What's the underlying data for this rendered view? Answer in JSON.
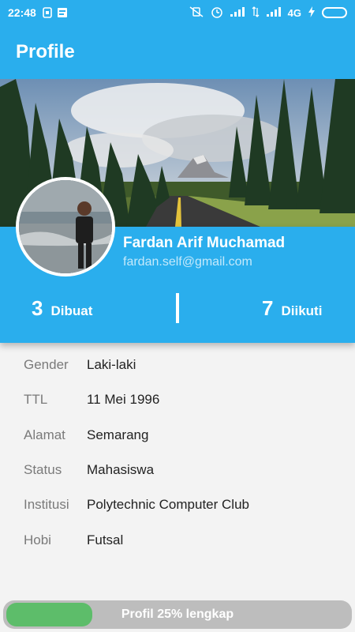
{
  "status_bar": {
    "time": "22:48",
    "network": "4G"
  },
  "header": {
    "title": "Profile"
  },
  "profile": {
    "name": "Fardan Arif Muchamad",
    "email": "fardan.self@gmail.com"
  },
  "stats": {
    "created_count": "3",
    "created_label": "Dibuat",
    "followed_count": "7",
    "followed_label": "Diikuti"
  },
  "details": [
    {
      "label": "Gender",
      "value": "Laki-laki"
    },
    {
      "label": "TTL",
      "value": "11 Mei 1996"
    },
    {
      "label": "Alamat",
      "value": "Semarang"
    },
    {
      "label": "Status",
      "value": "Mahasiswa"
    },
    {
      "label": "Institusi",
      "value": "Polytechnic Computer Club"
    },
    {
      "label": "Hobi",
      "value": "Futsal"
    }
  ],
  "progress": {
    "percent": 25,
    "label": "Profil 25% lengkap"
  },
  "colors": {
    "primary": "#2aaeed",
    "progress_fill": "#5dbd6a",
    "progress_track": "#bdbdbd"
  }
}
